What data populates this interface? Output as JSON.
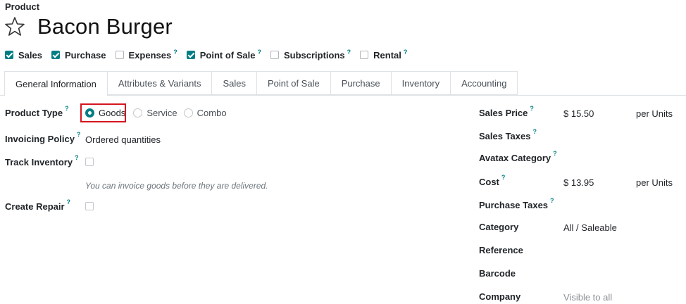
{
  "breadcrumb": "Product",
  "product_name": "Bacon Burger",
  "options": [
    {
      "label": "Sales",
      "checked": true,
      "help": false
    },
    {
      "label": "Purchase",
      "checked": true,
      "help": false
    },
    {
      "label": "Expenses",
      "checked": false,
      "help": true
    },
    {
      "label": "Point of Sale",
      "checked": true,
      "help": true
    },
    {
      "label": "Subscriptions",
      "checked": false,
      "help": true
    },
    {
      "label": "Rental",
      "checked": false,
      "help": true
    }
  ],
  "help_mark": "?",
  "tabs": [
    "General Information",
    "Attributes & Variants",
    "Sales",
    "Point of Sale",
    "Purchase",
    "Inventory",
    "Accounting"
  ],
  "left": {
    "product_type_label": "Product Type",
    "product_type_options": [
      "Goods",
      "Service",
      "Combo"
    ],
    "product_type_selected": "Goods",
    "invoicing_policy_label": "Invoicing Policy",
    "invoicing_policy_value": "Ordered quantities",
    "track_inventory_label": "Track Inventory",
    "track_inventory_checked": false,
    "invoice_hint": "You can invoice goods before they are delivered.",
    "create_repair_label": "Create Repair",
    "create_repair_checked": false
  },
  "right": {
    "sales_price_label": "Sales Price",
    "sales_price_value": "$ 15.50",
    "sales_price_unit": "per Units",
    "sales_taxes_label": "Sales Taxes",
    "avatax_label": "Avatax Category",
    "cost_label": "Cost",
    "cost_value": "$ 13.95",
    "cost_unit": "per Units",
    "purchase_taxes_label": "Purchase Taxes",
    "category_label": "Category",
    "category_value": "All / Saleable",
    "reference_label": "Reference",
    "barcode_label": "Barcode",
    "company_label": "Company",
    "company_value": "Visible to all"
  },
  "colors": {
    "accent": "#017e84",
    "highlight_border": "#d6151e"
  }
}
